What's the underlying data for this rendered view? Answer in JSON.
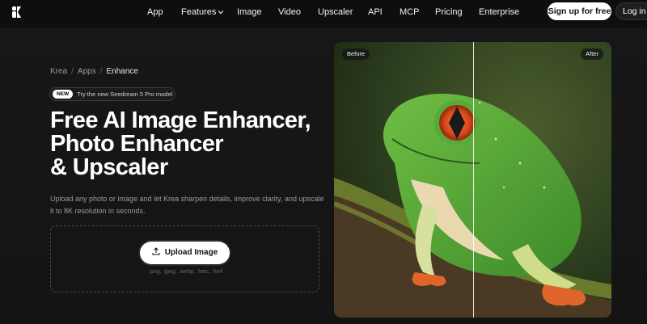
{
  "nav": {
    "logo_icon": "krea-logo-icon",
    "links": [
      {
        "label": "App"
      },
      {
        "label": "Features",
        "has_dropdown": true
      },
      {
        "label": "Image"
      },
      {
        "label": "Video"
      },
      {
        "label": "Upscaler"
      },
      {
        "label": "API"
      },
      {
        "label": "MCP"
      },
      {
        "label": "Pricing"
      },
      {
        "label": "Enterprise"
      }
    ],
    "signup_label": "Sign up for free",
    "login_label": "Log in"
  },
  "breadcrumb": {
    "items": [
      "Krea",
      "Apps",
      "Enhance"
    ]
  },
  "badge": {
    "tag": "NEW",
    "text": "Try the new Seedream 5 Pro model"
  },
  "hero": {
    "title_lines": [
      "Free AI Image Enhancer,",
      "Photo Enhancer",
      "& Upscaler"
    ],
    "description": "Upload any photo or image and let Krea sharpen details, improve clarity, and upscale it to 8K resolution in seconds."
  },
  "upload": {
    "button_label": "Upload Image",
    "formats": ".png, .jpeg, .webp, .heic, .heif"
  },
  "compare": {
    "before_label": "Before",
    "after_label": "After",
    "split_fraction": 0.5
  },
  "colors": {
    "background": "#0e0e0e",
    "accent_white": "#ffffff",
    "frog_green": "#5aa83a",
    "frog_eye": "#e2501c"
  }
}
